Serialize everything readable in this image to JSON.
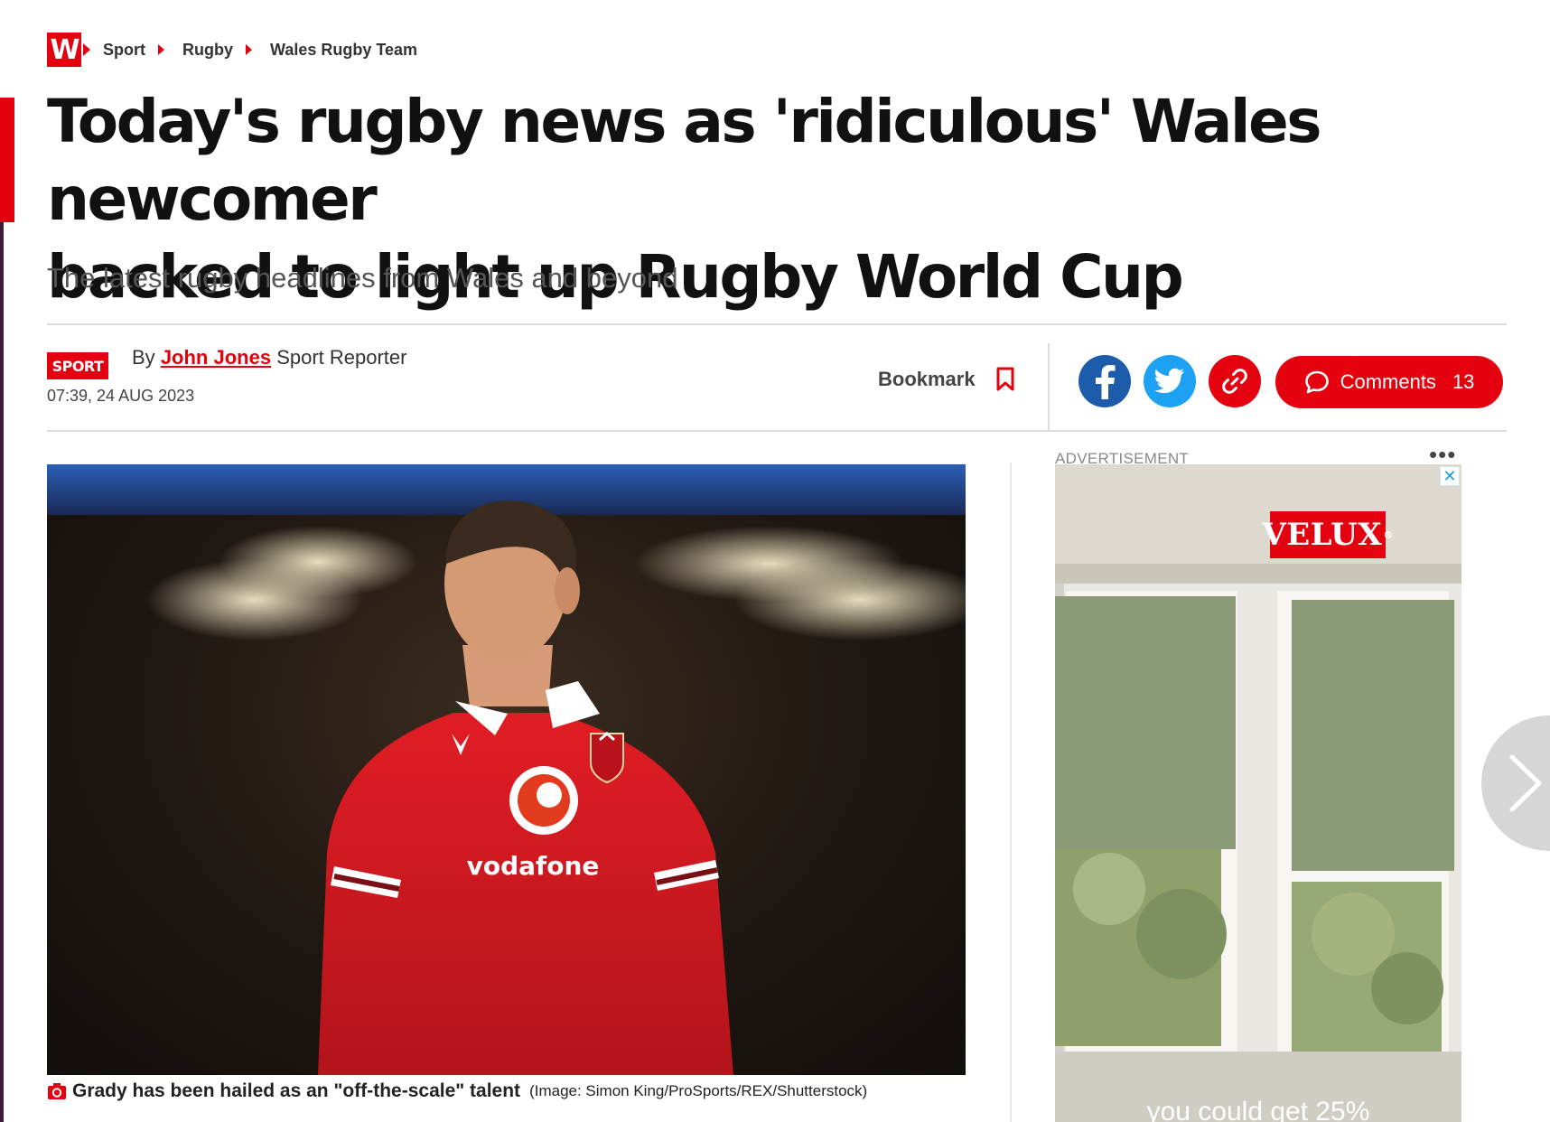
{
  "breadcrumb": {
    "logo_letter": "W",
    "items": [
      "Sport",
      "Rugby",
      "Wales Rugby Team"
    ]
  },
  "article": {
    "headline_line1": "Today's rugby news as 'ridiculous' Wales newcomer",
    "headline_line2": "backed to light up Rugby World Cup",
    "standfirst": "The latest rugby headlines from Wales and beyond",
    "section_tag": "SPORT",
    "by_label": "By",
    "author": "John Jones",
    "author_role": "Sport Reporter",
    "timestamp": "07:39, 24 AUG 2023"
  },
  "actions": {
    "bookmark_label": "Bookmark",
    "comments_label": "Comments",
    "comments_count": "13"
  },
  "hero": {
    "shirt_sponsor": "vodafone",
    "caption": "Grady has been hailed as an \"off-the-scale\" talent",
    "credit": "(Image: Simon King/ProSports/REX/Shutterstock)"
  },
  "advert": {
    "label": "ADVERTISEMENT",
    "brand": "VELUX",
    "brand_mark": "®",
    "tagline": "you could get 25%",
    "close_glyph": "✕",
    "more_glyph": "•••"
  },
  "colors": {
    "brand_red": "#e4000f",
    "facebook": "#1d5bab",
    "twitter": "#1da1f2",
    "link": "#e4000f"
  },
  "icons": [
    "bookmark-icon",
    "facebook-icon",
    "twitter-icon",
    "link-icon",
    "comment-icon",
    "camera-icon",
    "close-icon",
    "chevron-right-icon"
  ]
}
